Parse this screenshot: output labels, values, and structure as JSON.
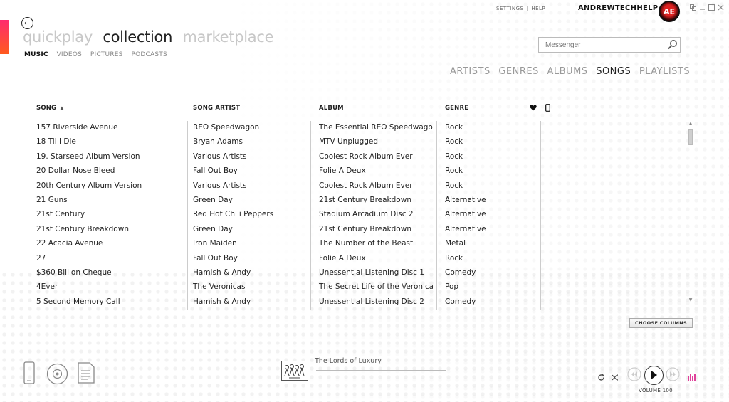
{
  "pivot": {
    "items": [
      "quickplay",
      "collection",
      "marketplace"
    ],
    "active": 1
  },
  "subpivot": {
    "items": [
      "MUSIC",
      "VIDEOS",
      "PICTURES",
      "PODCASTS"
    ],
    "active": 0
  },
  "header": {
    "settings": "SETTINGS",
    "separator": "|",
    "help": "HELP",
    "username": "ANDREWTECHHELP",
    "avatar_text": "AE"
  },
  "search": {
    "placeholder": "Messenger"
  },
  "view_tabs": {
    "items": [
      "ARTISTS",
      "GENRES",
      "ALBUMS",
      "SONGS",
      "PLAYLISTS"
    ],
    "active": 3
  },
  "columns": {
    "song": "SONG",
    "artist": "SONG ARTIST",
    "album": "ALBUM",
    "genre": "GENRE"
  },
  "songs": [
    {
      "song": "157 Riverside Avenue",
      "artist": "REO Speedwagon",
      "album": "The Essential REO Speedwagon",
      "genre": "Rock"
    },
    {
      "song": "18 Til I Die",
      "artist": "Bryan Adams",
      "album": "MTV Unplugged",
      "genre": "Rock"
    },
    {
      "song": "19. Starseed Album Version",
      "artist": "Various Artists",
      "album": "Coolest Rock Album Ever",
      "genre": "Rock"
    },
    {
      "song": "20 Dollar Nose Bleed",
      "artist": "Fall Out Boy",
      "album": "Folie A Deux",
      "genre": "Rock"
    },
    {
      "song": "20th Century Album Version",
      "artist": "Various Artists",
      "album": "Coolest Rock Album Ever",
      "genre": "Rock"
    },
    {
      "song": "21 Guns",
      "artist": "Green Day",
      "album": "21st Century Breakdown",
      "genre": "Alternative"
    },
    {
      "song": "21st Century",
      "artist": "Red Hot Chili Peppers",
      "album": "Stadium Arcadium Disc 2",
      "genre": "Alternative"
    },
    {
      "song": "21st Century Breakdown",
      "artist": "Green Day",
      "album": "21st Century Breakdown",
      "genre": "Alternative"
    },
    {
      "song": "22 Acacia Avenue",
      "artist": "Iron Maiden",
      "album": "The Number of the Beast",
      "genre": "Metal"
    },
    {
      "song": "27",
      "artist": "Fall Out Boy",
      "album": "Folie A Deux",
      "genre": "Rock"
    },
    {
      "song": "$360 Billion Cheque",
      "artist": "Hamish & Andy",
      "album": "Unessential Listening Disc 1",
      "genre": "Comedy"
    },
    {
      "song": "4Ever",
      "artist": "The Veronicas",
      "album": "The Secret Life of the Veronicas",
      "genre": "Pop"
    },
    {
      "song": "5 Second Memory Call",
      "artist": "Hamish & Andy",
      "album": "Unessential Listening Disc 2",
      "genre": "Comedy"
    }
  ],
  "choose_columns": "CHOOSE COLUMNS",
  "now_playing": {
    "title": "The Lords of Luxury"
  },
  "volume": "VOLUME 100",
  "accent_color": "#ff2a6e"
}
